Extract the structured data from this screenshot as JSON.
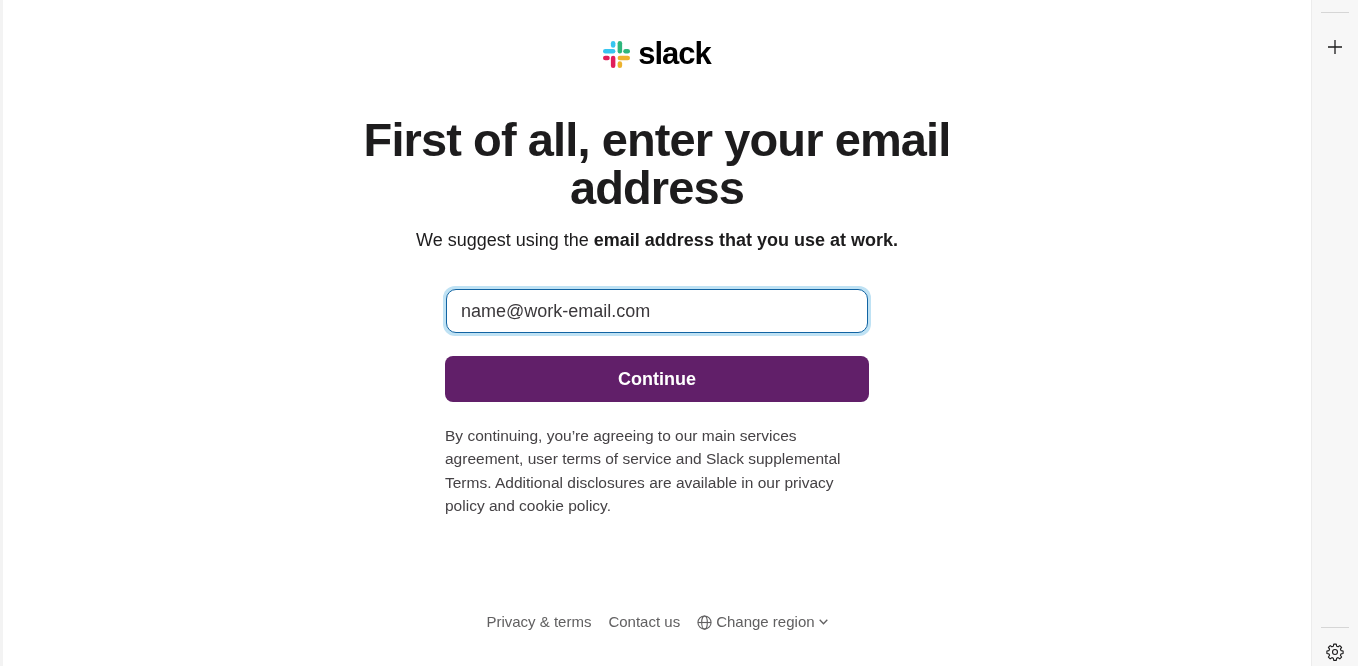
{
  "logo": {
    "wordmark": "slack"
  },
  "heading": "First of all, enter your email address",
  "subtitle": "We suggest using the **email address that you use at work.**",
  "email_field": {
    "placeholder": "name@work-email.com",
    "focused": true
  },
  "continue_button": {
    "label": "Continue"
  },
  "legal_text": "By continuing, you’re agreeing to our main services agreement, user terms of service and Slack supplemental Terms. Additional disclosures are available in our privacy policy and cookie policy.",
  "footer_links": [
    {
      "label": "Privacy & terms",
      "kind": "link"
    },
    {
      "label": "Contact us",
      "kind": "link"
    },
    {
      "label": "Change region",
      "kind": "menu"
    }
  ]
}
